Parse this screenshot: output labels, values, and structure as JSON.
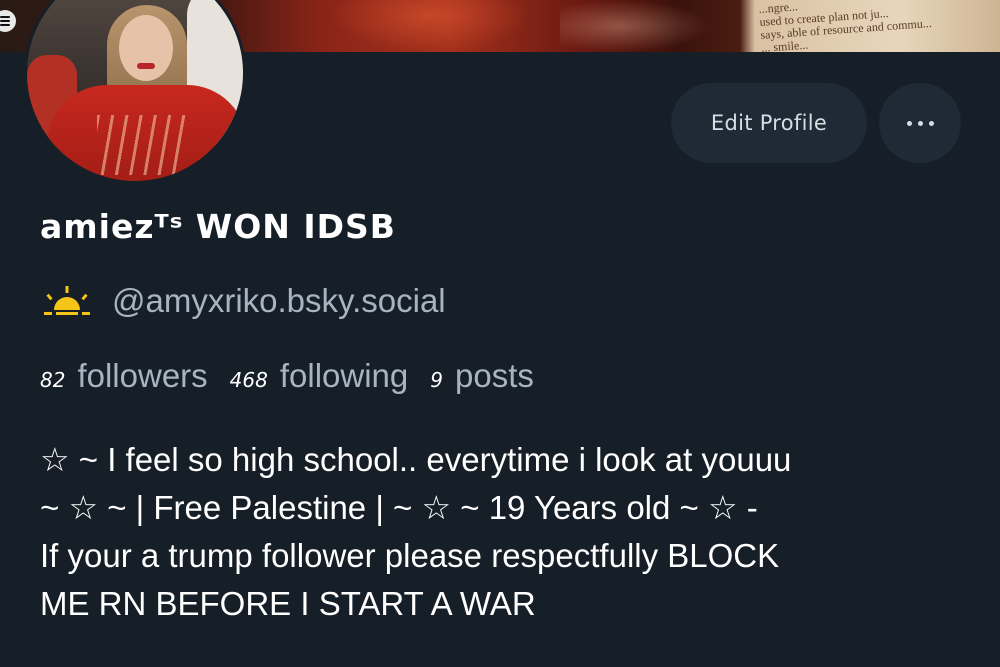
{
  "banner": {
    "text_lines": [
      "...ngre...",
      "used to create plan not ju...",
      "says, able of resource and commu...",
      "... smile..."
    ]
  },
  "profile": {
    "display_name": "amiezᵀˢ WON IDSB",
    "handle": "@amyxriko.bsky.social",
    "handle_icon": "sun-icon"
  },
  "actions": {
    "edit_label": "Edit Profile",
    "more_icon": "ellipsis-icon"
  },
  "stats": {
    "followers_count": "82",
    "followers_label": "followers",
    "following_count": "468",
    "following_label": "following",
    "posts_count": "9",
    "posts_label": "posts"
  },
  "bio": {
    "lines": [
      "☆ ~ I feel so high school.. everytime i look at youuu",
      "~ ☆ ~ | Free Palestine | ~ ☆ ~ 19 Years old ~ ☆ -",
      "If your a trump follower please respectfully BLOCK",
      "ME RN BEFORE I START A WAR"
    ]
  },
  "colors": {
    "background": "#161e27",
    "button_bg": "#1e2a36",
    "muted_text": "#a7b4c2",
    "sun_yellow": "#f5c518"
  }
}
